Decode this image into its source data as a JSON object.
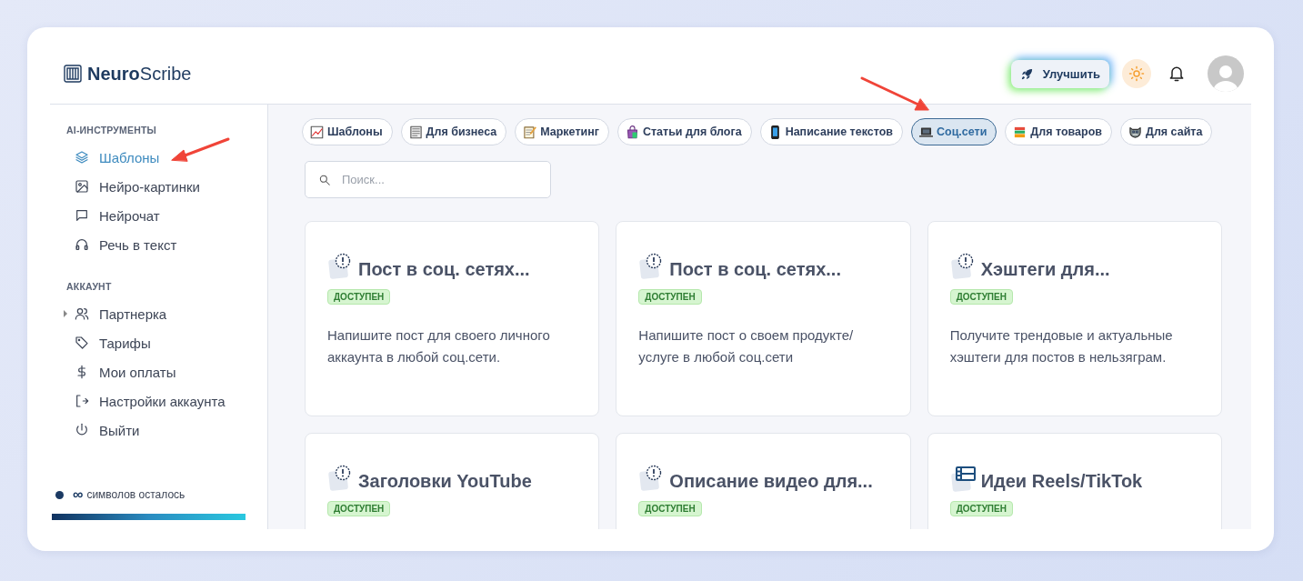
{
  "brand": {
    "bold": "Neuro",
    "rest": "Scribe"
  },
  "header": {
    "upgrade_label": "Улучшить"
  },
  "sidebar": {
    "sections": [
      {
        "heading": "AI-ИНСТРУМЕНТЫ",
        "items": [
          {
            "label": "Шаблоны",
            "kind": "link",
            "selected": true
          },
          {
            "label": "Нейро-картинки",
            "kind": "link",
            "selected": false
          },
          {
            "label": "Нейрочат",
            "kind": "link",
            "selected": false
          },
          {
            "label": "Речь в текст",
            "kind": "link",
            "selected": false
          }
        ]
      },
      {
        "heading": "АККАУНТ",
        "items": [
          {
            "label": "Партнерка",
            "kind": "group",
            "selected": false
          },
          {
            "label": "Тарифы",
            "kind": "link",
            "selected": false
          },
          {
            "label": "Мои оплаты",
            "kind": "link",
            "selected": false
          },
          {
            "label": "Настройки аккаунта",
            "kind": "link",
            "selected": false
          },
          {
            "label": "Выйти",
            "kind": "link",
            "selected": false
          }
        ]
      }
    ],
    "quota": {
      "amount": "∞",
      "label": "символов осталось",
      "level": 1
    }
  },
  "chips": [
    {
      "label": "Шаблоны",
      "selected": false
    },
    {
      "label": "Для бизнеса",
      "selected": false
    },
    {
      "label": "Маркетинг",
      "selected": false
    },
    {
      "label": "Статьи для блога",
      "selected": false
    },
    {
      "label": "Написание текстов",
      "selected": false
    },
    {
      "label": "Соц.сети",
      "selected": true
    },
    {
      "label": "Для товаров",
      "selected": false
    },
    {
      "label": "Для сайта",
      "selected": false
    }
  ],
  "search": {
    "placeholder": "Поиск..."
  },
  "cards": [
    {
      "title": "Пост в соц. сетях...",
      "kind": "text",
      "badge": "ДОСТУПЕН",
      "description": "Напишите пост для своего личного аккаунта в любой соц.сети."
    },
    {
      "title": "Пост в соц. сетях...",
      "kind": "text",
      "badge": "ДОСТУПЕН",
      "description": "Напишите пост о своем продукте/услуге в любой соц.сети"
    },
    {
      "title": "Хэштеги для...",
      "kind": "text",
      "badge": "ДОСТУПЕН",
      "description": "Получите трендовые и актуальные хэштеги для постов в нельзяграм."
    },
    {
      "title": "Заголовки YouTube",
      "kind": "text",
      "badge": "ДОСТУПЕН"
    },
    {
      "title": "Описание видео для...",
      "kind": "text",
      "badge": "ДОСТУПЕН"
    },
    {
      "title": "Идеи Reels/TikTok",
      "kind": "video",
      "badge": "ДОСТУПЕН"
    }
  ]
}
